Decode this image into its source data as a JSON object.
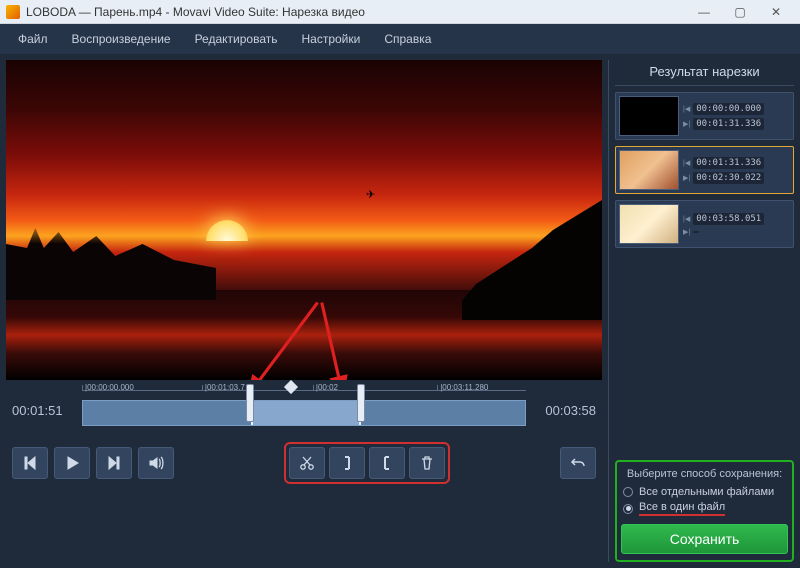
{
  "window": {
    "title": "LOBODA — Парень.mp4 - Movavi Video Suite: Нарезка видео",
    "minimize": "—",
    "maximize": "▢",
    "close": "✕"
  },
  "menu": {
    "file": "Файл",
    "playback": "Воспроизведение",
    "edit": "Редактировать",
    "settings": "Настройки",
    "help": "Справка"
  },
  "timeline": {
    "current": "00:01:51",
    "total": "00:03:58",
    "ticks": {
      "t0": "|00:00:00.000",
      "t1": "|00:01:03.7",
      "t2": "|00:02",
      "t3": "|00:03:11.280"
    }
  },
  "panel": {
    "title": "Результат нарезки"
  },
  "clips": [
    {
      "start": "00:00:00.000",
      "end": "00:01:31.336"
    },
    {
      "start": "00:01:31.336",
      "end": "00:02:30.022"
    },
    {
      "start": "00:03:58.051",
      "end": ""
    }
  ],
  "save": {
    "prompt": "Выберите способ сохранения:",
    "opt1": "Все отдельными файлами",
    "opt2": "Все в один файл",
    "button": "Сохранить"
  }
}
